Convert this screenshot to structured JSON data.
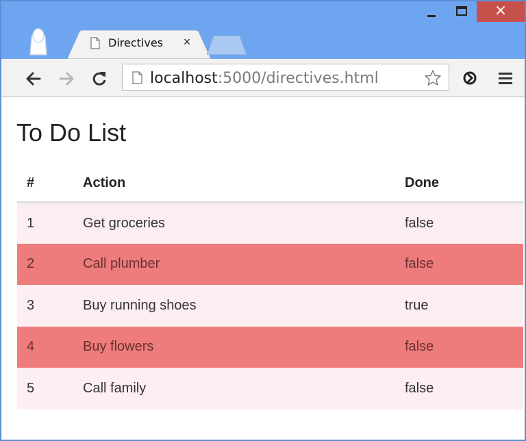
{
  "browser": {
    "tab": {
      "title": "Directives",
      "close_glyph": "×"
    },
    "address": {
      "host": "localhost",
      "rest": ":5000/directives.html"
    },
    "window_close_glyph": "×",
    "icons": [
      "profile-icon",
      "page-icon",
      "back-icon",
      "forward-icon",
      "reload-icon",
      "star-icon",
      "extension-icon",
      "menu-icon",
      "minimize-icon",
      "maximize-icon",
      "close-icon"
    ]
  },
  "page": {
    "title": "To Do List",
    "table": {
      "headers": [
        "#",
        "Action",
        "Done"
      ],
      "rows": [
        {
          "num": "1",
          "action": "Get groceries",
          "done": "false"
        },
        {
          "num": "2",
          "action": "Call plumber",
          "done": "false"
        },
        {
          "num": "3",
          "action": "Buy running shoes",
          "done": "true"
        },
        {
          "num": "4",
          "action": "Buy flowers",
          "done": "false"
        },
        {
          "num": "5",
          "action": "Call family",
          "done": "false"
        }
      ]
    }
  },
  "colors": {
    "titlebar": "#6ea5f0",
    "close_button": "#c7504b",
    "row_light": "#fdeef1",
    "row_highlight": "#ee7c7c"
  }
}
